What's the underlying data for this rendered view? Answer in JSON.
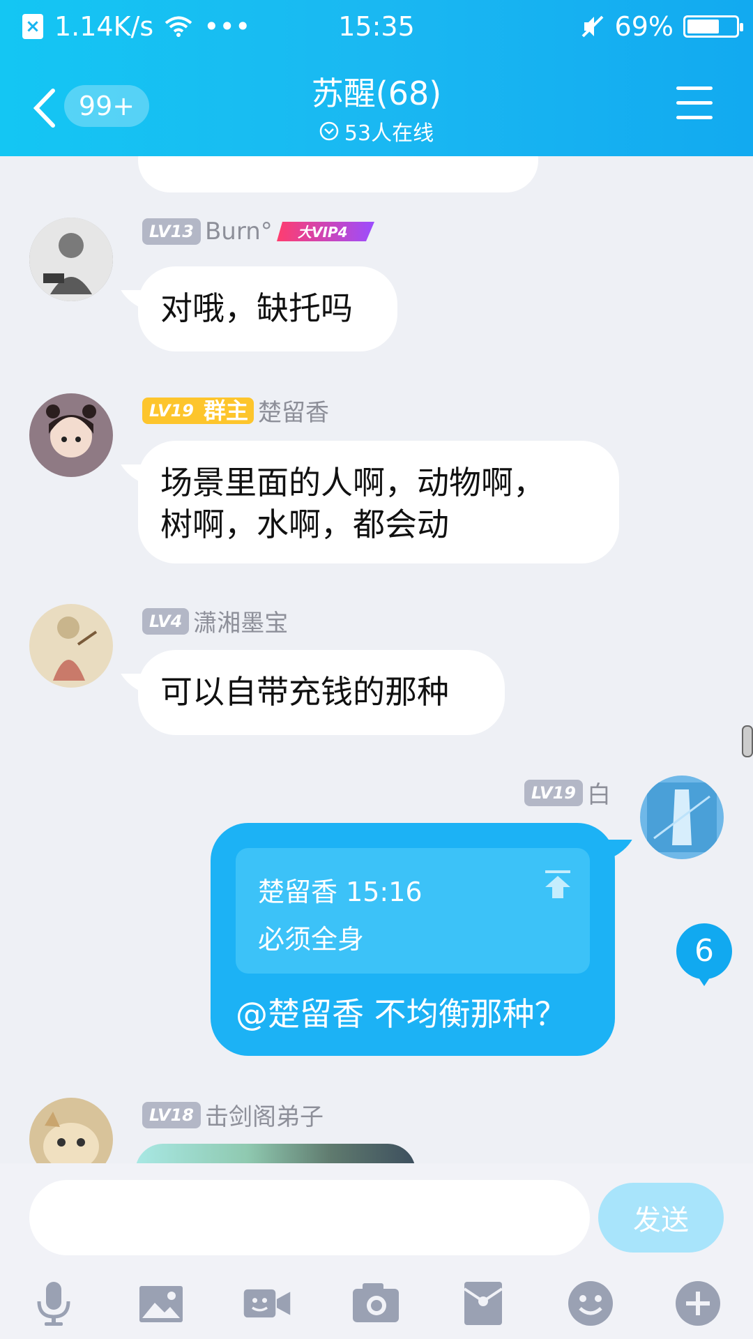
{
  "status_bar": {
    "network_speed": "1.14K/s",
    "more": "•••",
    "time": "15:35",
    "battery": "69%",
    "battery_level": 0.69
  },
  "header": {
    "unread_count": "99+",
    "title": "苏醒(68)",
    "online": "53人在线"
  },
  "messages": [
    {
      "level": "LV13",
      "name": "Burn°",
      "badge": "大VIP4",
      "text": "对哦，缺托吗"
    },
    {
      "level": "LV19",
      "role": "群主",
      "name": "楚留香",
      "line1": "场景里面的人啊，动物啊，",
      "line2": "树啊，水啊，都会动"
    },
    {
      "level": "LV4",
      "name": "潇湘墨宝",
      "text": "可以自带充钱的那种"
    },
    {
      "level": "LV19",
      "name": "白",
      "quote_head": "楚留香 15:16",
      "quote_body": "必须全身",
      "text": "@楚留香 不均衡那种？"
    },
    {
      "level": "LV18",
      "name": "击剑阁弟子"
    }
  ],
  "new_messages_badge": "6",
  "input": {
    "placeholder": "",
    "send_label": "发送"
  },
  "colors": {
    "header": "#17b5f1",
    "accent": "#1cb2f5",
    "background": "#eef0f5"
  }
}
